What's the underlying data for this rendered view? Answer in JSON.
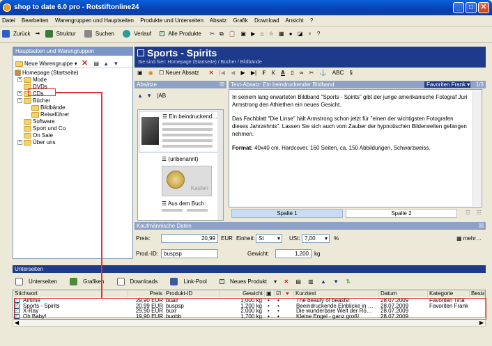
{
  "window": {
    "title": "shop to date 6.0 pro - Rotstiftonline24"
  },
  "menu": [
    "Datei",
    "Bearbeiten",
    "Warengruppen und Hauptseiten",
    "Produkte und Unterseiten",
    "Absatz",
    "Grafik",
    "Download",
    "Ansicht",
    "?"
  ],
  "toolbar": {
    "back": "Zurück",
    "struktur": "Struktur",
    "suchen": "Suchen",
    "verlauf": "Verlauf",
    "alle": "Alle Produkte"
  },
  "left": {
    "header": "Hauptseiten und Warengruppen",
    "new_group": "Neue Warengruppe",
    "tree": [
      "Homepage (Startseite)",
      "Mode",
      "DVDs",
      "CDs",
      "Bücher",
      "Bildbände",
      "Reiseführer",
      "Software",
      "Sport und Co",
      "On Sale",
      "Über uns"
    ]
  },
  "page": {
    "title": "Sports - Spirits",
    "breadcrumb": "Sie sind hier: Homepage (Startseite) / Bücher / Bildbände",
    "new_paragraph": "Neuer Absatz"
  },
  "absaetze": {
    "header": "Absätze",
    "item1": "Ein beindruckend…",
    "item2": "(unbenannt)",
    "item3": "Aus dem Buch:",
    "buy": "Kaufen"
  },
  "text": {
    "header": "Text-Absatz: Ein beindruckender Bildband",
    "favorites": "Favoriten Frank",
    "pager": "1/3",
    "p1": "In seinem lang erwarteten Bildband \"Sports - Spirits\" gibt der junge amerikanische Fotograf Juri Armstrong den Athlethen ein neues Gesicht.",
    "p2": "Das Fachblatt \"Die Linse\" hält Armstrong schon jetzt für \"einen der wichtigsten Fotografen dieses Jahrzehnts\". Lassen Sie sich auch vom Zauber der hypnotischen Bilderwelten gefangen nehmen.",
    "p3_label": "Format:",
    "p3": " 40x40 cm, Hardcover, 160 Seiten, ca. 150 Abbildungen, Schwarzweiss.",
    "col1": "Spalte 1",
    "col2": "Spalte 2"
  },
  "kauf": {
    "header": "Kaufmännische Daten",
    "preis_label": "Preis:",
    "preis": "20,99",
    "eur": "EUR",
    "einheit_label": "Einheit:",
    "einheit": "St",
    "ust_label": "USt:",
    "ust": "7,00",
    "pct": "%",
    "mehr": "mehr…",
    "id_label": "Prod.-ID:",
    "id": "buspsp",
    "gewicht_label": "Gewicht:",
    "gewicht": "1,200",
    "kg": "kg"
  },
  "unterseiten": {
    "header": "Unterseiten",
    "tabs": [
      "Unterseiten",
      "Grafiken",
      "Downloads",
      "Link-Pool",
      "Neues Produkt"
    ],
    "columns": [
      "Stichwort",
      "Preis",
      "Produkt-ID",
      "Gewicht",
      "",
      "",
      "",
      "Kurztext",
      "Datum",
      "Kategorie",
      "Bestan"
    ],
    "rows": [
      {
        "name": "Airtime",
        "price": "29,90 EUR",
        "id": "buair",
        "weight": "1,000 kg",
        "text": "The beauty of beasts!",
        "date": "28.07.2009",
        "cat": "Favoriten Tina"
      },
      {
        "name": "Sports - Spirits",
        "price": "20,99 EUR",
        "id": "buspsp",
        "weight": "1,200 kg",
        "text": "Beeindruckende Einblicke in …",
        "date": "28.07.2009",
        "cat": "Favoriten Frank"
      },
      {
        "name": "X-Ray",
        "price": "29,90 EUR",
        "id": "buxr",
        "weight": "2,000 kg",
        "text": "Die wunderbare Welt der Rö…",
        "date": "28.07.2009",
        "cat": ""
      },
      {
        "name": "Oh Baby!",
        "price": "19,90 EUR",
        "id": "buobb",
        "weight": "1,700 kg",
        "text": "Kleine Engel - ganz groß!",
        "date": "28.07.2009",
        "cat": ""
      }
    ]
  }
}
